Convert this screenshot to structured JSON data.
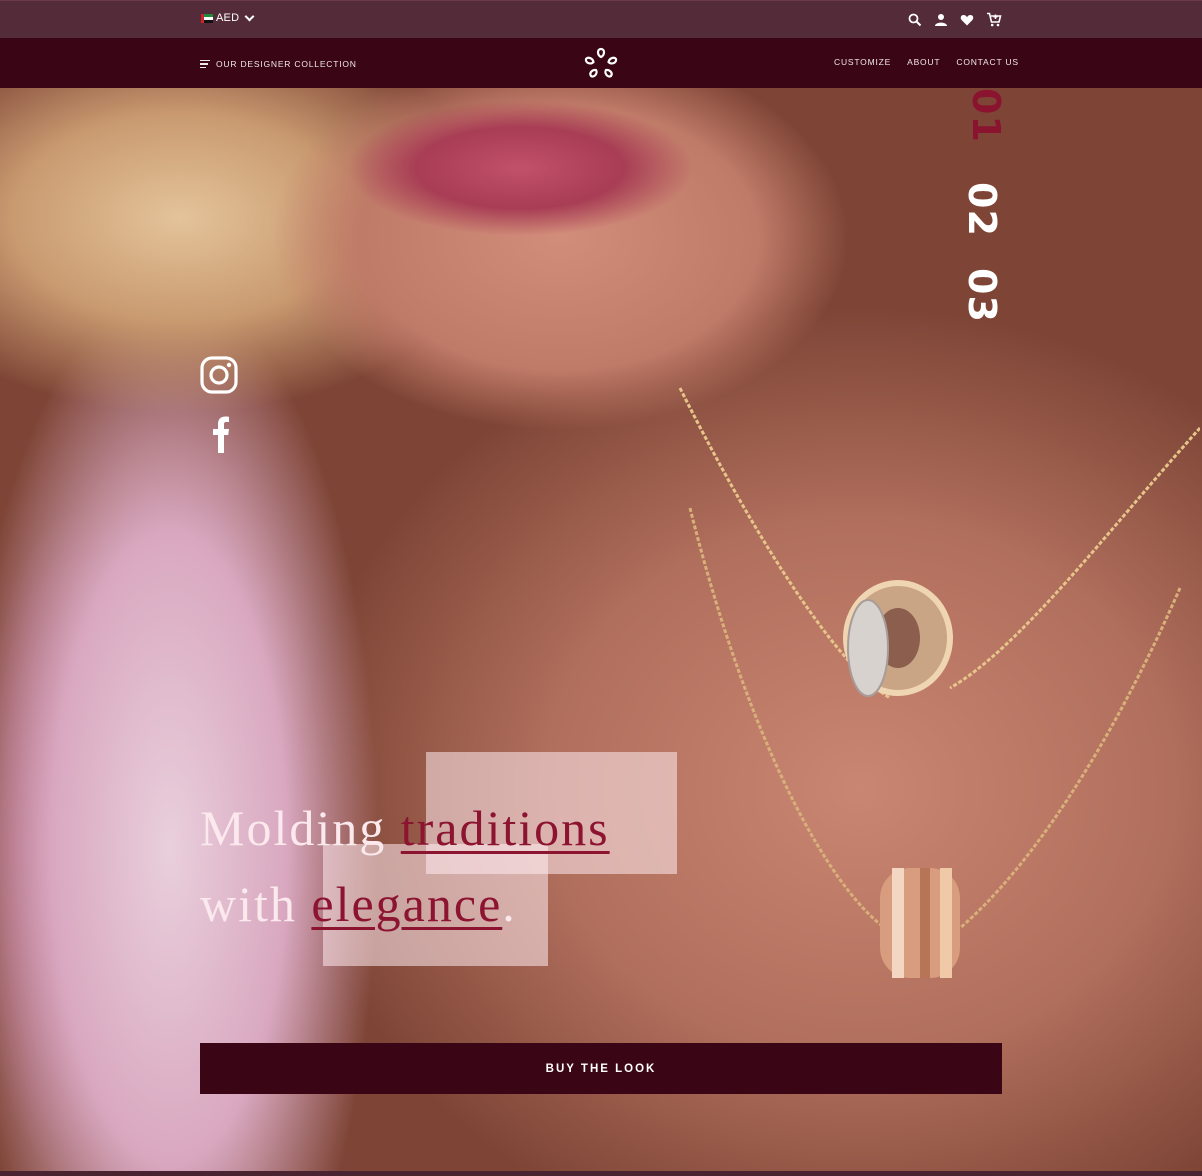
{
  "utility_bar": {
    "currency": "AED",
    "flag_colors": [
      "#d0242d",
      "#1f8a3b",
      "#ffffff",
      "#111111"
    ],
    "icons": [
      "search-icon",
      "account-icon",
      "wishlist-heart-icon",
      "cart-icon"
    ]
  },
  "nav": {
    "collection_label": "OUR DESIGNER COLLECTION",
    "links": [
      "CUSTOMIZE",
      "ABOUT",
      "CONTACT US"
    ]
  },
  "hero": {
    "slides": [
      "01",
      "02",
      "03"
    ],
    "active_slide": "01",
    "headline": {
      "word1": "Molding",
      "accent1": "traditions",
      "word2": "with",
      "accent2": "elegance",
      "period": "."
    },
    "cta_label": "BUY THE LOOK",
    "social_icons": [
      "instagram-icon",
      "facebook-icon"
    ]
  },
  "colors": {
    "brand_dark": "#3a0615",
    "utility_bg": "#542b39",
    "accent": "#8c1431"
  }
}
